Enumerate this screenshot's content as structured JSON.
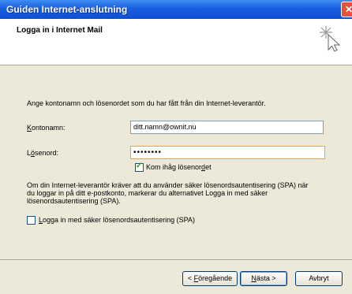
{
  "window": {
    "title": "Guiden Internet-anslutning",
    "close_glyph": "✕"
  },
  "header": {
    "title": "Logga in i Internet Mail",
    "icon": "wizard-sparkle-cursor-icon"
  },
  "intro": "Ange kontonamn och lösenordet som du har fått från din Internet-leverantör.",
  "account": {
    "label_u": "K",
    "label_rest": "ontonamn:",
    "value": "ditt.namn@ownit.nu"
  },
  "password": {
    "label_pre": "L",
    "label_u": "ö",
    "label_rest": "senord:",
    "value": "••••••••"
  },
  "remember": {
    "label_pre": "Kom ihåg lösenor",
    "label_u": "d",
    "label_post": "et",
    "checked": true
  },
  "spa_text": "Om din Internet-leverantör kräver att du använder säker lösenordsautentisering (SPA) när du loggar in på ditt e-postkonto, markerar du alternativet Logga in med säker lösenordsautentisering (SPA).",
  "spa_checkbox": {
    "label_u": "L",
    "label_rest": "ogga in med säker lösenordsautentisering (SPA)",
    "checked": false
  },
  "buttons": {
    "back_pre": "< ",
    "back_u": "F",
    "back_rest": "öregående",
    "next_u": "N",
    "next_rest": "ästa >",
    "cancel": "Avbryt"
  }
}
